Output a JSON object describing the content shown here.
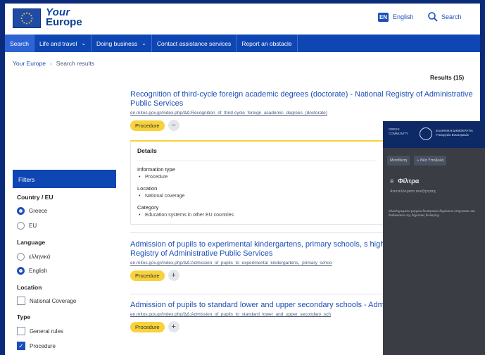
{
  "header": {
    "logo_line1": "Your",
    "logo_line2": "Europe",
    "lang_code": "EN",
    "lang_label": "English",
    "search_label": "Search"
  },
  "nav": {
    "items": [
      {
        "label": "Search",
        "dropdown": false,
        "active": true
      },
      {
        "label": "Life and travel",
        "dropdown": true,
        "active": false
      },
      {
        "label": "Doing business",
        "dropdown": true,
        "active": false
      },
      {
        "label": "Contact assistance services",
        "dropdown": false,
        "active": false
      },
      {
        "label": "Report an obstacle",
        "dropdown": false,
        "active": false
      }
    ]
  },
  "breadcrumb": {
    "home": "Your Europe",
    "current": "Search results"
  },
  "results_count": "Results (15)",
  "results": [
    {
      "title": "Recognition of third-cycle foreign academic degrees (doctorate) - National Registry of Administrative Public Services",
      "url": "en.mitos.gov.gr/index.php/ΔΔ:Recognition_of_third-cycle_foreign_academic_degrees_(doctorate)",
      "tag": "Procedure",
      "toggle": "−"
    },
    {
      "title": "Admission of pupils to experimental kindergartens, primary schools, s high schools - National Registry of Administrative Public Services",
      "url": "en.mitos.gov.gr/index.php/ΔΔ:Admission_of_pupils_to_experimental_kindergartens,_primary_schoo",
      "tag": "Procedure",
      "toggle": "+"
    },
    {
      "title": "Admission of pupils to standard lower and upper secondary schools - Administrative Public Services",
      "url": "en.mitos.gov.gr/index.php/ΔΔ:Admission_of_pupils_to_standard_lower_and_upper_secondary_sch",
      "tag": "Procedure",
      "toggle": "+"
    }
  ],
  "details": {
    "title": "Details",
    "info_type_label": "Information type",
    "info_type_value": "Procedure",
    "location_label": "Location",
    "location_value": "National coverage",
    "category_label": "Category",
    "category_value": "Education systems in other EU countries"
  },
  "filters": {
    "title": "Filters",
    "country_label": "Country / EU",
    "country_options": [
      {
        "label": "Greece",
        "checked": true
      },
      {
        "label": "EU",
        "checked": false
      }
    ],
    "language_label": "Language",
    "language_options": [
      {
        "label": "ελληνικά",
        "checked": false
      },
      {
        "label": "English",
        "checked": true
      }
    ],
    "location_label": "Location",
    "location_options": [
      {
        "label": "National Coverage",
        "checked": false
      }
    ],
    "type_label": "Type",
    "type_options": [
      {
        "label": "General rules",
        "checked": false
      },
      {
        "label": "Procedure",
        "checked": true
      }
    ]
  },
  "phone": {
    "logo_text": "GREEK COMMUNITY",
    "ministry_line1": "ΕΛΛΗΝΙΚΗ ΔΗΜΟΚΡΑΤΙΑ",
    "ministry_line2": "Υπουργείο Εσωτερικών",
    "tab1": "Μετάθεση",
    "tab2": "+ Νέα Υποβολή",
    "filter_title": "Φίλτρα",
    "filter_subtitle": "Αποτελέσματα αναζήτησης",
    "body_text": "Ολοκληρωμένο μητρώο διοικητικών δημόσιων υπηρεσιών και διαδικασιών της δημόσιας διοίκησης."
  }
}
